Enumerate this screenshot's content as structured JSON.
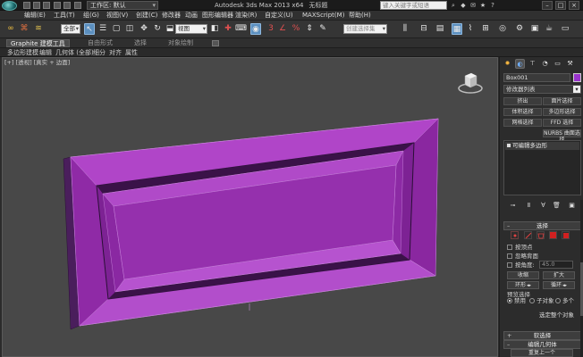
{
  "titlebar": {
    "workspace_label": "工作区: 默认",
    "app_title": "Autodesk 3ds Max  2013 x64",
    "file_title": "无标题",
    "search_placeholder": "键入关键字或短语"
  },
  "menu": {
    "items": [
      "编辑(E)",
      "工具(T)",
      "组(G)",
      "视图(V)",
      "创建(C)",
      "修改器",
      "动画",
      "图形编辑器",
      "渲染(R)",
      "自定义(U)",
      "MAXScript(M)",
      "帮助(H)"
    ]
  },
  "toolbar": {
    "filter_value": "全部",
    "view_value": "视图",
    "selection_set_placeholder": "创建选择集"
  },
  "ribbon": {
    "tabs": [
      "Graphite 建模工具",
      "自由形式",
      "选择",
      "对象绘制"
    ],
    "sub_items": [
      "多边形建模",
      "编辑",
      "几何体 (全部)",
      "细分",
      "对齐",
      "属性"
    ]
  },
  "viewport": {
    "labels": [
      "[+]",
      "[透视]",
      "[真实 + 边面]"
    ],
    "object_color": "#9933cc"
  },
  "command_panel": {
    "object_name": "Box001",
    "object_color": "#9933cc",
    "modifier_list": "修改器列表",
    "mod_buttons": [
      "挤出",
      "面片选择",
      "体积选择",
      "多边形选择",
      "网格选择",
      "FFD 选择",
      "NURBS 曲面选择"
    ],
    "stack_item": "可编辑多边形",
    "selection_rollout": {
      "title": "选择",
      "by_vertex": "按顶点",
      "ignore_backfacing": "忽略背面",
      "by_angle": "按角度:",
      "angle_value": "45.0",
      "shrink": "收缩",
      "grow": "扩大",
      "ring": "环形",
      "loop": "循环",
      "preview_label": "预览选择",
      "preview_options": [
        "禁用",
        "子对象",
        "多个"
      ],
      "status": "选定整个对象"
    },
    "soft_selection_title": "软选择",
    "edit_geometry_title": "编辑几何体",
    "repeat_last": "重复上一个"
  }
}
